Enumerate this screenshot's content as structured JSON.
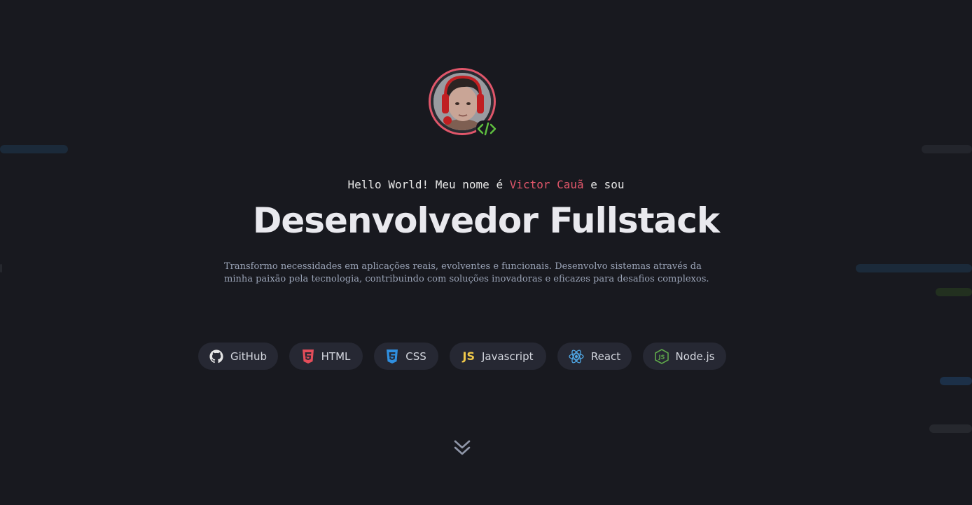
{
  "hero": {
    "greeting_prefix": "Hello World! Meu nome é ",
    "name": "Victor Cauã",
    "greeting_suffix": " e sou",
    "role": "Desenvolvedor Fullstack",
    "description": "Transformo necessidades em aplicações reais, evolventes e funcionais. Desenvolvo sistemas através da minha paixão pela tecnologia, contribuindo com soluções inovadoras e eficazes para desafios complexos."
  },
  "avatar": {
    "border_color": "#e0566a",
    "badge_icon": "code-icon",
    "badge_color": "#5fbf3f"
  },
  "skills": [
    {
      "label": "GitHub",
      "icon": "github-icon",
      "color": "#e6e6e6"
    },
    {
      "label": "HTML",
      "icon": "html5-icon",
      "color": "#e44d5a"
    },
    {
      "label": "CSS",
      "icon": "css3-icon",
      "color": "#2f8fe0"
    },
    {
      "label": "Javascript",
      "icon": "js-icon",
      "color": "#f0c94a"
    },
    {
      "label": "React",
      "icon": "react-icon",
      "color": "#4fa8e6"
    },
    {
      "label": "Node.js",
      "icon": "nodejs-icon",
      "color": "#5fa84a"
    }
  ],
  "scroll": {
    "icon": "double-chevron-down-icon"
  },
  "colors": {
    "background": "#18191f",
    "accent": "#e0566a",
    "chip_background": "#262833",
    "description": "#9aa3b6"
  }
}
